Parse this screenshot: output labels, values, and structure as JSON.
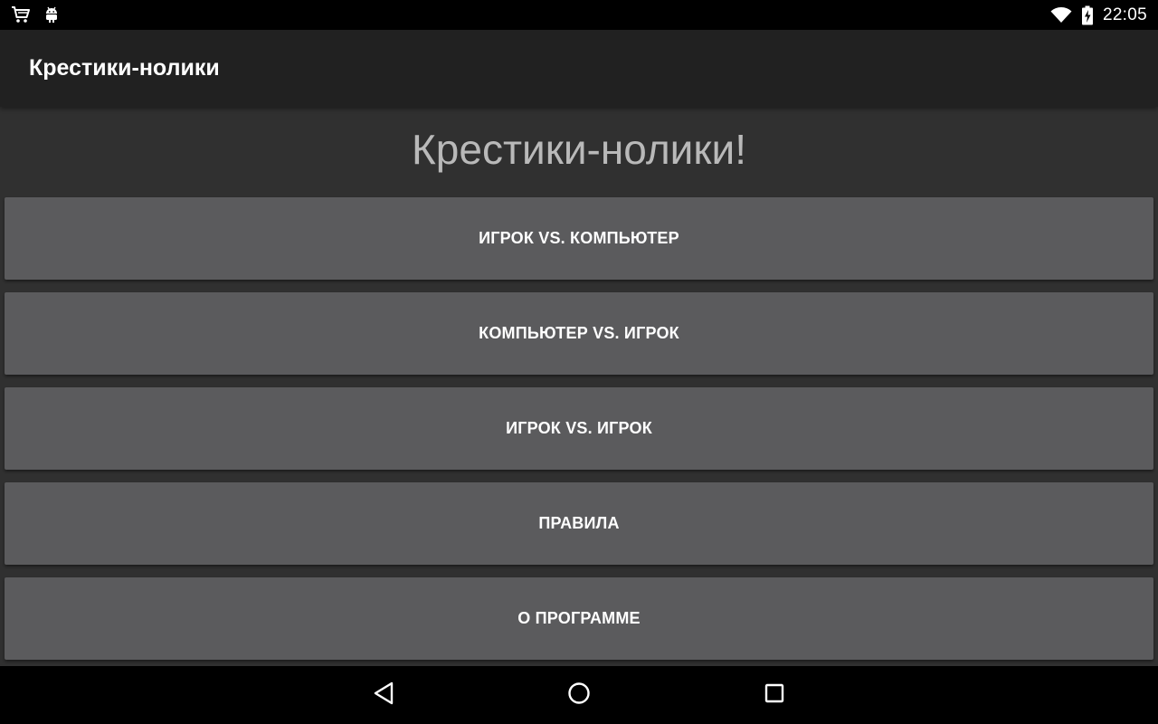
{
  "status_bar": {
    "time": "22:05",
    "left_icons": [
      "shopping-cart-icon",
      "android-debug-icon"
    ],
    "right_icons": [
      "wifi-icon",
      "battery-charging-icon"
    ]
  },
  "action_bar": {
    "title": "Крестики-нолики"
  },
  "main": {
    "heading": "Крестики-нолики!",
    "buttons": [
      {
        "label": "ИГРОК VS. КОМПЬЮТЕР"
      },
      {
        "label": "КОМПЬЮТЕР VS. ИГРОК"
      },
      {
        "label": "ИГРОК VS. ИГРОК"
      },
      {
        "label": "ПРАВИЛА"
      },
      {
        "label": "О ПРОГРАММЕ"
      }
    ]
  },
  "nav_bar": {
    "icons": [
      "back-icon",
      "home-icon",
      "recents-icon"
    ]
  },
  "colors": {
    "status_bar_bg": "#000000",
    "action_bar_bg": "#212121",
    "content_bg": "#303030",
    "button_bg": "#5b5b5d",
    "heading_text": "#b9b9b9"
  }
}
